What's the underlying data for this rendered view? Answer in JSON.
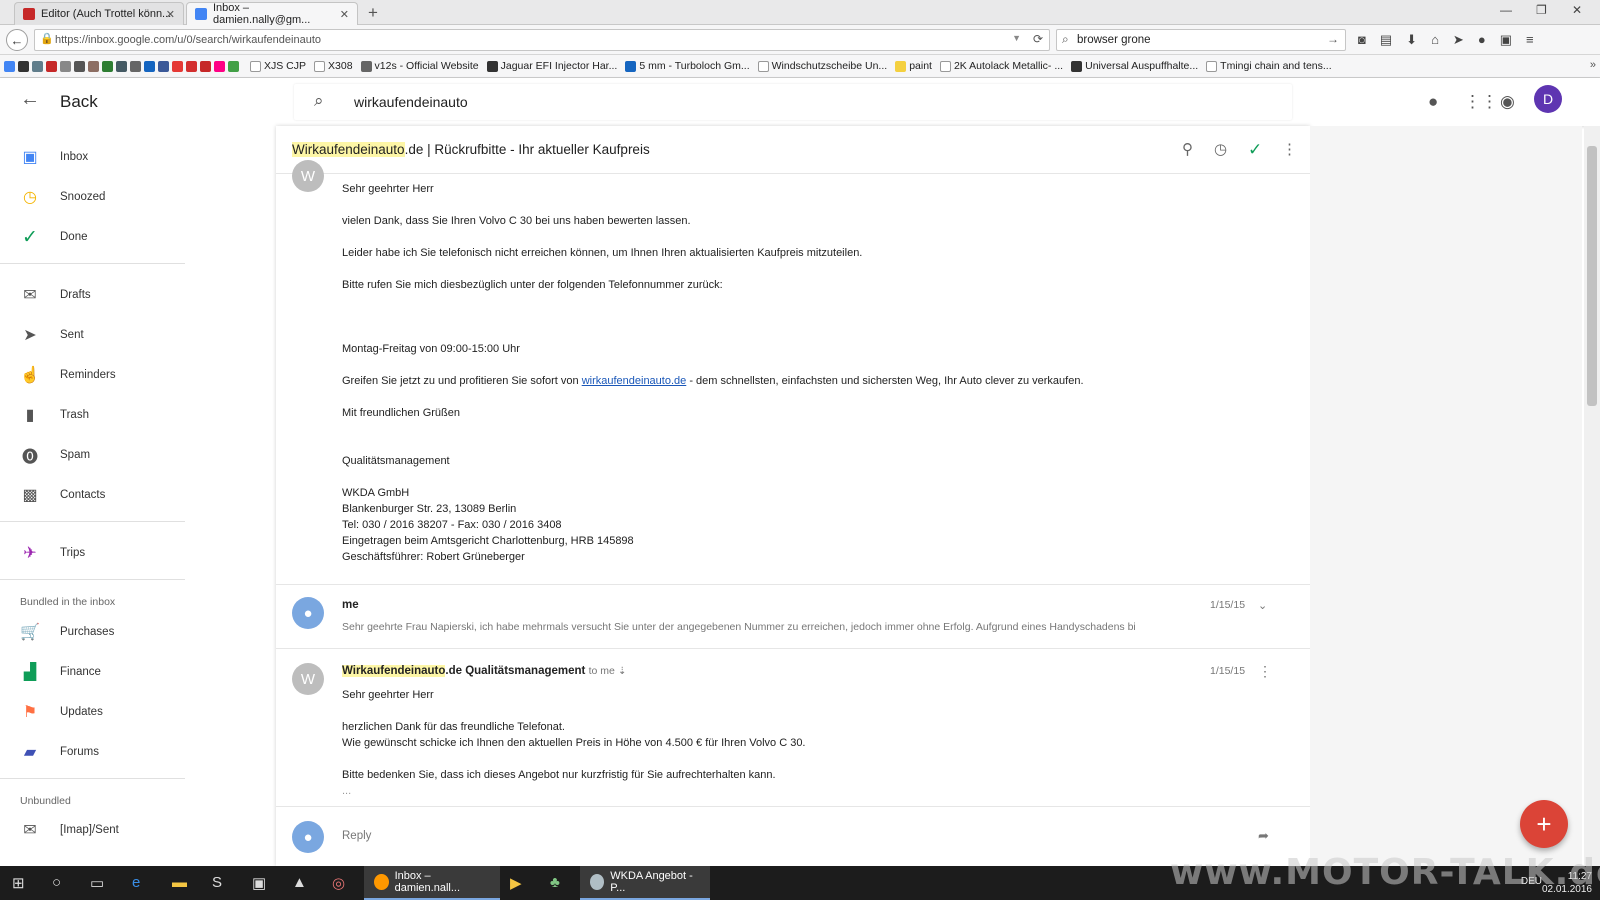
{
  "browser": {
    "tabs": [
      {
        "title": "Editor (Auch Trottel könn...",
        "active": false
      },
      {
        "title": "Inbox – damien.nally@gm...",
        "active": true
      }
    ],
    "url": "https://inbox.google.com/u/0/search/wirkaufendeinauto",
    "search_value": "browser grone",
    "bookmarks": [
      "XJS CJP",
      "X308",
      "v12s - Official Website",
      "Jaguar EFI Injector Har...",
      "5 mm - Turboloch Gm...",
      "Windschutzscheibe Un...",
      "paint",
      "2K Autolack Metallic- ...",
      "Universal Auspuffhalte...",
      "Tmingi chain and tens..."
    ]
  },
  "appbar": {
    "back_label": "Back",
    "search_value": "wirkaufendeinauto",
    "avatar_letter": "D"
  },
  "sidebar": {
    "items": [
      {
        "label": "Inbox",
        "icon": "inbox-icon",
        "color": "#4285f4"
      },
      {
        "label": "Snoozed",
        "icon": "clock-icon",
        "color": "#f4b400"
      },
      {
        "label": "Done",
        "icon": "check-icon",
        "color": "#0f9d58"
      },
      {
        "label": "Drafts",
        "icon": "drafts-icon",
        "color": "#555555"
      },
      {
        "label": "Sent",
        "icon": "send-icon",
        "color": "#555555"
      },
      {
        "label": "Reminders",
        "icon": "reminder-icon",
        "color": "#555555"
      },
      {
        "label": "Trash",
        "icon": "trash-icon",
        "color": "#555555"
      },
      {
        "label": "Spam",
        "icon": "spam-icon",
        "color": "#555555"
      },
      {
        "label": "Contacts",
        "icon": "contacts-icon",
        "color": "#555555"
      },
      {
        "label": "Trips",
        "icon": "plane-icon",
        "color": "#9c27b0"
      }
    ],
    "bundled_header": "Bundled in the inbox",
    "bundled": [
      {
        "label": "Purchases",
        "icon": "cart-icon",
        "color": "#795548"
      },
      {
        "label": "Finance",
        "icon": "finance-icon",
        "color": "#0f9d58"
      },
      {
        "label": "Updates",
        "icon": "flag-icon",
        "color": "#ff7043"
      },
      {
        "label": "Forums",
        "icon": "forums-icon",
        "color": "#3f51b5"
      }
    ],
    "unbundled_header": "Unbundled",
    "unbundled": [
      {
        "label": "[Imap]/Sent",
        "icon": "mail-icon",
        "color": "#555555"
      }
    ]
  },
  "thread": {
    "subject_highlight": "Wirkaufendeinauto",
    "subject_rest": ".de | Rückrufbitte - Ihr aktueller Kaufpreis",
    "message1": {
      "avatar_letter": "W",
      "greeting": "Sehr geehrter Herr",
      "p1": "vielen Dank, dass Sie Ihren Volvo C 30 bei uns haben bewerten lassen.",
      "p2": "Leider habe ich Sie telefonisch nicht erreichen können, um Ihnen Ihren aktualisierten Kaufpreis mitzuteilen.",
      "p3": "Bitte rufen Sie mich diesbezüglich unter der folgenden Telefonnummer zurück:",
      "hours": "Montag-Freitag von 09:00-15:00 Uhr",
      "p4_before": "Greifen Sie jetzt zu und profitieren Sie sofort von",
      "p4_link": "wirkaufendeinauto.de",
      "p4_after": "- dem schnellsten, einfachsten und sichersten Weg, Ihr Auto clever zu verkaufen.",
      "closing": "Mit freundlichen Grüßen",
      "dept": "Qualitätsmanagement",
      "company": "WKDA GmbH",
      "address": "Blankenburger Str. 23, 13089 Berlin",
      "tel": "Tel: 030 / 2016 38207 - Fax: 030 / 2016 3408",
      "register": "Eingetragen beim Amtsgericht Charlottenburg, HRB 145898",
      "ceo": "Geschäftsführer: Robert Grüneberger"
    },
    "message2": {
      "sender": "me",
      "snippet": "Sehr geehrte Frau Napierski, ich habe mehrmals versucht Sie unter der angegebenen Nummer zu erreichen, jedoch immer ohne Erfolg. Aufgrund eines Handyschadens bi",
      "date": "1/15/15"
    },
    "message3": {
      "avatar_letter": "W",
      "sender_highlight": "Wirkaufendeinauto",
      "sender_rest": ".de Qualitätsmanagement",
      "to": "to me",
      "date": "1/15/15",
      "greeting": "Sehr geehrter Herr",
      "l1": "herzlichen Dank für das freundliche Telefonat.",
      "l2": "Wie gewünscht schicke ich Ihnen den aktuellen Preis in Höhe von 4.500 € für Ihren Volvo C 30.",
      "l3": "Bitte bedenken Sie, dass ich dieses Angebot nur kurzfristig für Sie aufrechterhalten kann.",
      "more": "..."
    },
    "reply_placeholder": "Reply"
  },
  "taskbar": {
    "tasks": [
      "Inbox – damien.nall...",
      "WKDA Angebot - P..."
    ],
    "language": "DEU",
    "time": "11:27",
    "date": "02.01.2016"
  },
  "watermark": "www.MOTOR-TALK.de",
  "colors": {
    "accent": "#4285f4",
    "fab": "#db4437",
    "done": "#0f9d58",
    "highlight": "#fdf6a6",
    "avatar": "#5e35b1"
  }
}
